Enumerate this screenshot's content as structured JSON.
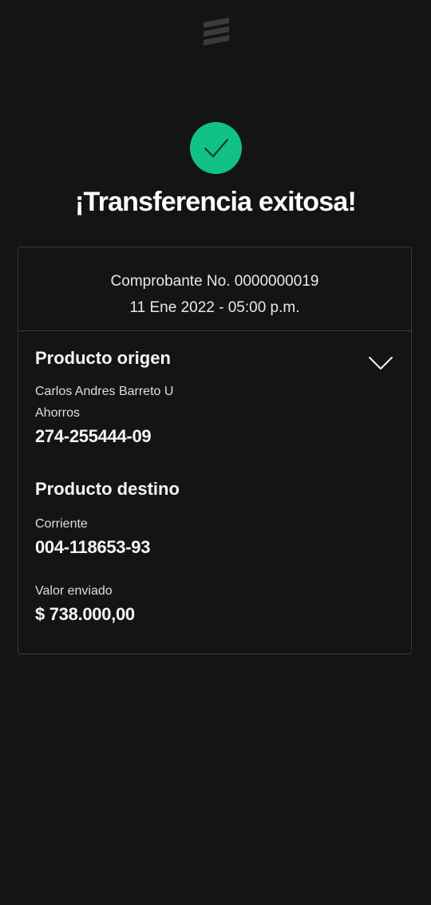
{
  "header": {
    "logo_icon": "bank-logo-icon"
  },
  "status": {
    "icon": "check-icon",
    "accent_color": "#12c187",
    "title": "¡Transferencia exitosa!"
  },
  "receipt": {
    "number_line": "Comprobante No. 0000000019",
    "datetime_line": "11 Ene 2022 - 05:00 p.m."
  },
  "origin": {
    "heading": "Producto origen",
    "owner_name": "Carlos Andres Barreto U",
    "account_type": "Ahorros",
    "account_number": "274-255444-09",
    "toggle_icon": "chevron-down-icon"
  },
  "destination": {
    "heading": "Producto destino",
    "account_type": "Corriente",
    "account_number": "004-118653-93"
  },
  "amount": {
    "label": "Valor enviado",
    "value": "$ 738.000,00"
  }
}
